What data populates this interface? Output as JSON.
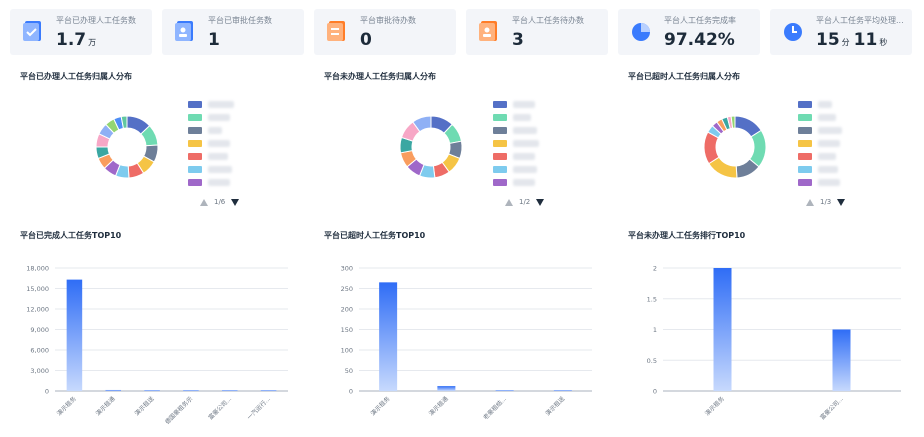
{
  "stats": [
    {
      "label": "平台已办理人工任务数",
      "value": "1.7",
      "unit": "万",
      "icon": "document-check-icon",
      "color": "#3a7bfd"
    },
    {
      "label": "平台已审批任务数",
      "value": "1",
      "unit": "",
      "icon": "id-card-icon",
      "color": "#3a7bfd"
    },
    {
      "label": "平台审批待办数",
      "value": "0",
      "unit": "",
      "icon": "pending-doc-icon",
      "color": "#ff7d28"
    },
    {
      "label": "平台人工任务待办数",
      "value": "3",
      "unit": "",
      "icon": "task-doc-icon",
      "color": "#ff7d28"
    },
    {
      "label": "平台人工任务完成率",
      "value": "97.42%",
      "unit": "",
      "icon": "pie-icon",
      "color": "#3a7bfd"
    },
    {
      "label": "平台人工任务平均处理...",
      "value": "15",
      "unit": "分",
      "value2": "11",
      "unit2": "秒",
      "icon": "clock-icon",
      "color": "#3a7bfd"
    }
  ],
  "donuts": [
    {
      "title": "平台已办理人工任务归属人分布",
      "pager": "1/6",
      "slices": [
        {
          "value": 13,
          "color": "#5470c6"
        },
        {
          "value": 11,
          "color": "#6fdbb2"
        },
        {
          "value": 9,
          "color": "#6e7f99"
        },
        {
          "value": 8,
          "color": "#f5c445"
        },
        {
          "value": 8,
          "color": "#ee6c66"
        },
        {
          "value": 7,
          "color": "#7ecbee"
        },
        {
          "value": 7,
          "color": "#9f68c9"
        },
        {
          "value": 6,
          "color": "#f99d5e"
        },
        {
          "value": 6,
          "color": "#3aa7a2"
        },
        {
          "value": 7,
          "color": "#f7a7c6"
        },
        {
          "value": 6,
          "color": "#8fb0f5"
        },
        {
          "value": 5,
          "color": "#93d572"
        },
        {
          "value": 4,
          "color": "#4e8ef5"
        },
        {
          "value": 3,
          "color": "#60c7a0"
        }
      ]
    },
    {
      "title": "平台未办理人工任务归属人分布",
      "pager": "1/2",
      "slices": [
        {
          "value": 12,
          "color": "#5470c6"
        },
        {
          "value": 10,
          "color": "#6fdbb2"
        },
        {
          "value": 9,
          "color": "#6e7f99"
        },
        {
          "value": 9,
          "color": "#f5c445"
        },
        {
          "value": 8,
          "color": "#ee6c66"
        },
        {
          "value": 8,
          "color": "#7ecbee"
        },
        {
          "value": 8,
          "color": "#9f68c9"
        },
        {
          "value": 8,
          "color": "#f99d5e"
        },
        {
          "value": 8,
          "color": "#3aa7a2"
        },
        {
          "value": 10,
          "color": "#f7a7c6"
        },
        {
          "value": 10,
          "color": "#8fb0f5"
        }
      ]
    },
    {
      "title": "平台已超时人工任务归属人分布",
      "pager": "1/3",
      "slices": [
        {
          "value": 16,
          "color": "#5470c6"
        },
        {
          "value": 20,
          "color": "#6fdbb2"
        },
        {
          "value": 13,
          "color": "#6e7f99"
        },
        {
          "value": 17,
          "color": "#f5c445"
        },
        {
          "value": 17,
          "color": "#ee6c66"
        },
        {
          "value": 4,
          "color": "#7ecbee"
        },
        {
          "value": 3,
          "color": "#9f68c9"
        },
        {
          "value": 3,
          "color": "#f99d5e"
        },
        {
          "value": 3,
          "color": "#3aa7a2"
        },
        {
          "value": 2,
          "color": "#f7a7c6"
        },
        {
          "value": 2,
          "color": "#93d572"
        }
      ]
    }
  ],
  "legend_colors": [
    "#5470c6",
    "#6fdbb2",
    "#6e7f99",
    "#f5c445",
    "#ee6c66",
    "#7ecbee",
    "#9f68c9"
  ],
  "chart_data": [
    {
      "type": "bar",
      "title": "平台已完成人工任务TOP10",
      "categories": [
        "演示租务",
        "演示租通",
        "演示租送",
        "德国豪租务示",
        "富豪公司...",
        "一汽运行..."
      ],
      "values": [
        16300,
        150,
        80,
        60,
        40,
        30
      ],
      "ylim": [
        0,
        18000
      ],
      "yticks": [
        "0",
        "3,000",
        "6,000",
        "9,000",
        "12,000",
        "15,000",
        "18,000"
      ]
    },
    {
      "title": "平台已超时人工任务TOP10",
      "type": "bar",
      "categories": [
        "演示租务",
        "演示租通",
        "老豪租结...",
        "演示租送"
      ],
      "values": [
        265,
        12,
        1,
        1
      ],
      "ylim": [
        0,
        300
      ],
      "yticks": [
        "0",
        "50",
        "100",
        "150",
        "200",
        "250",
        "300"
      ]
    },
    {
      "title": "平台未办理人工任务排行TOP10",
      "type": "bar",
      "categories": [
        "演示租务",
        "富豪公司..."
      ],
      "values": [
        2,
        1
      ],
      "ylim": [
        0,
        2
      ],
      "yticks": [
        "0",
        "0.5",
        "1",
        "1.5",
        "2"
      ]
    }
  ]
}
